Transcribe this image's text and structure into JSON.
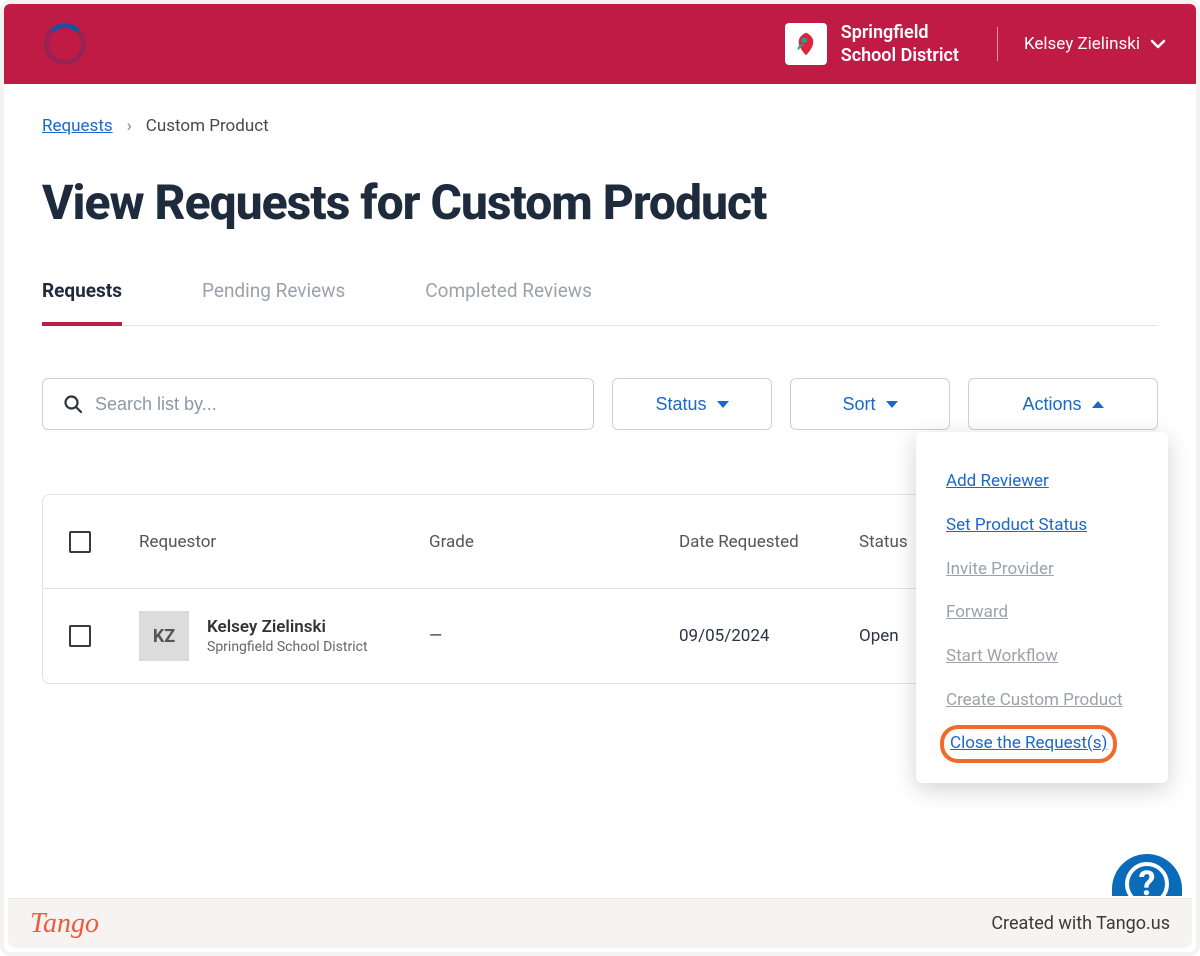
{
  "header": {
    "org_line1": "Springfield",
    "org_line2": "School District",
    "user_name": "Kelsey Zielinski"
  },
  "breadcrumb": {
    "root": "Requests",
    "current": "Custom Product"
  },
  "page": {
    "title": "View Requests for Custom Product"
  },
  "tabs": [
    {
      "label": "Requests",
      "active": true
    },
    {
      "label": "Pending Reviews",
      "active": false
    },
    {
      "label": "Completed Reviews",
      "active": false
    }
  ],
  "controls": {
    "search_placeholder": "Search list by...",
    "status_label": "Status",
    "sort_label": "Sort",
    "actions_label": "Actions"
  },
  "table": {
    "columns": {
      "requestor": "Requestor",
      "grade": "Grade",
      "date_requested": "Date Requested",
      "status": "Status"
    },
    "rows": [
      {
        "avatar_initials": "KZ",
        "requestor_name": "Kelsey Zielinski",
        "requestor_org": "Springfield School District",
        "grade": "—",
        "date_requested": "09/05/2024",
        "status": "Open"
      }
    ]
  },
  "actions_menu": [
    {
      "label": "Add Reviewer",
      "enabled": true
    },
    {
      "label": "Set Product Status",
      "enabled": true
    },
    {
      "label": "Invite Provider",
      "enabled": false
    },
    {
      "label": "Forward",
      "enabled": false
    },
    {
      "label": "Start Workflow",
      "enabled": false
    },
    {
      "label": "Create Custom Product",
      "enabled": false
    },
    {
      "label": "Close the Request(s)",
      "enabled": true,
      "highlighted": true
    }
  ],
  "footer": {
    "brand": "Tango",
    "credit": "Created with Tango.us"
  }
}
